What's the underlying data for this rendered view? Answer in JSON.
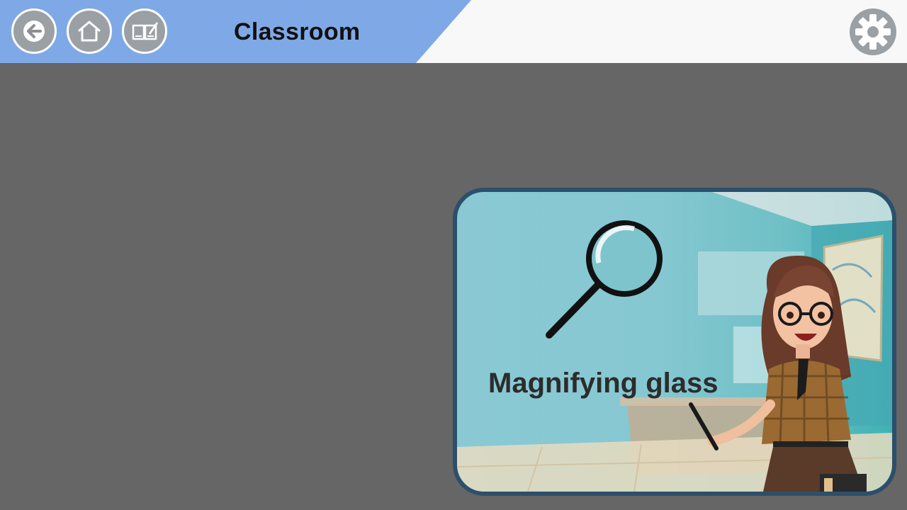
{
  "header": {
    "title": "Classroom",
    "buttons": [
      {
        "name": "back-button",
        "icon": "arrow-left-icon"
      },
      {
        "name": "home-button",
        "icon": "home-icon"
      },
      {
        "name": "book-button",
        "icon": "book-edit-icon"
      }
    ],
    "settings_icon": "gear-icon"
  },
  "card": {
    "label": "Magnifying glass",
    "image": "magnifying-glass-icon",
    "character": "teacher-character"
  },
  "colors": {
    "header_blue": "#7fa9e6",
    "header_white": "#f8f8f8",
    "background": "#666666",
    "card_border": "#2c4f6b",
    "button_gray": "#9aa0a4"
  }
}
